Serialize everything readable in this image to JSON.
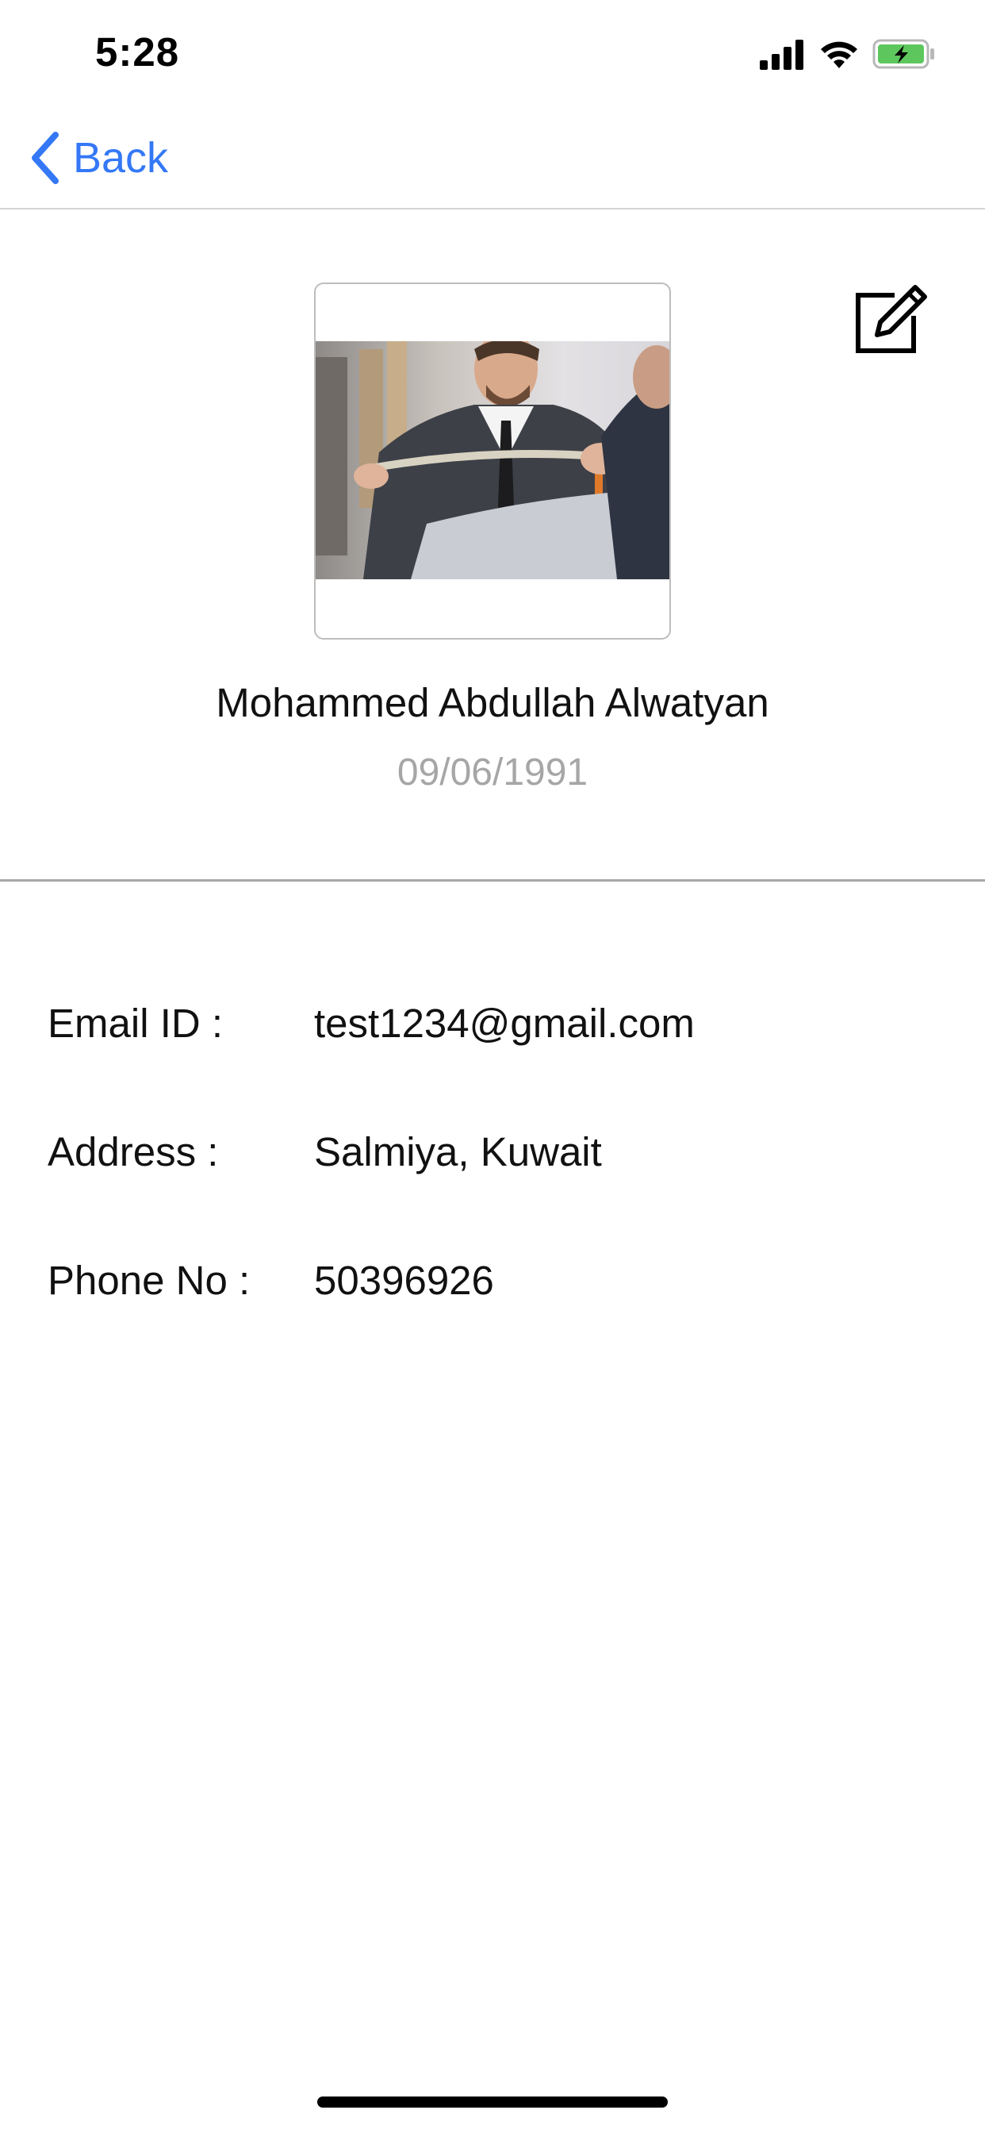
{
  "status_bar": {
    "time": "5:28",
    "icons": [
      "signal-icon",
      "wifi-icon",
      "battery-charging-icon"
    ],
    "battery_color": "#5dc75e"
  },
  "nav": {
    "back_label": "Back",
    "accent_color": "#3478f6"
  },
  "profile": {
    "photo": "tailor-measuring-suit-photo",
    "edit_icon": "edit-icon",
    "name": "Mohammed Abdullah Alwatyan",
    "dob": "09/06/1991"
  },
  "details": {
    "email_label": "Email ID :",
    "email_value": "test1234@gmail.com",
    "address_label": "Address :",
    "address_value": "Salmiya, Kuwait",
    "phone_label": "Phone No :",
    "phone_value": "50396926"
  }
}
